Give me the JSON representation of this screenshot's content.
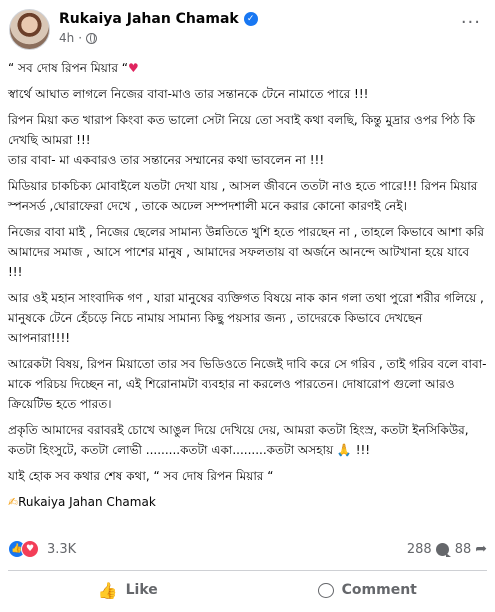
{
  "author": {
    "name": "Rukaiya Jahan Chamak",
    "time": "4h",
    "verified_icon": "verified-check-icon",
    "privacy_icon": "globe-icon"
  },
  "menu": {
    "icon": "more-options-icon",
    "label": "···"
  },
  "post": {
    "line1_text": "“ সব দোষ রিপন মিয়ার “",
    "line1_emoji": "♥",
    "p1": "স্বার্থে আঘাত লাগলে নিজের বাবা-মাও তার সন্তানকে টেনে নামাতে পারে !!!",
    "p2": "রিপন মিয়া কত খারাপ কিংবা কত ভালো সেটা নিয়ে তো সবাই কথা বলছি, কিন্তু মুদ্রার ওপর পিঠ কি দেখছি আমরা !!!",
    "p3": "তার বাবা- মা একবারও তার সন্তানের সম্মানের কথা ভাবলেন না !!!",
    "p4": "মিডিয়ার চাকচিক্য মোবাইলে যতটা দেখা যায় , আসল জীবনে ততটা নাও হতে পারে!!! রিপন মিয়ার স্পনসর্ড ,ঘোরাফেরা  দেখে , তাকে অঢেল সম্পদশালী মনে করার কোনো কারণই নেই।",
    "p5": "নিজের বাবা মাই , নিজের ছেলের সামান্য উন্নতিতে খুশি হতে পারছেন না , তাহলে কিভাবে আশা করি আমাদের সমাজ , আসে পাশের মানুষ , আমাদের সফলতায় বা অর্জনে আনন্দে আটখানা হয়ে যাবে !!!",
    "p6": "আর ওই মহান সাংবাদিক গণ , যারা মানুষের ব্যক্তিগত বিষয়ে নাক কান গলা তথা পুরো শরীর গলিয়ে , মানুষকে টেনে হেঁচড়ে নিচে নামায় সামান্য কিছু পয়সার জন্য , তাদেরকে কিভাবে দেখছেন আপনারা!!!!",
    "p7": "আরেকটা বিষয়, রিপন মিয়াতো তার সব ভিডিওতে নিজেই দাবি করে সে গরিব , তাই গরিব বলে বাবা- মাকে পরিচয় দিচ্ছেন না, এই শিরোনামটা ব্যবহার না করলেও পারতেন। দোষারোপ গুলো আরও ক্রিয়েটিভ হতে পারত।",
    "p8_text": "প্রকৃতি আমাদের বরাবরই চোখে আঙুল দিয়ে দেখিয়ে দেয়, আমরা কতটা হিংস্র, কতটা ইনসিকিউর, কতটা হিংসুটে, কতটা লোভী .........কতটা একা.........কতটা অসহায়",
    "p8_emoji": "🙏",
    "p8_end": "!!!",
    "p9": "যাই হোক সব কথার শেষ কথা, “ সব দোষ রিপন মিয়ার “",
    "signature_emoji": "✍",
    "signature": "Rukaiya Jahan Chamak"
  },
  "stats": {
    "reaction_count": "3.3K",
    "reaction_icons": [
      "like-reaction-icon",
      "love-reaction-icon"
    ],
    "comments": "288",
    "shares": "88"
  },
  "actions": {
    "like": "Like",
    "comment": "Comment"
  },
  "colors": {
    "accent": "#1877f2",
    "love": "#f33e58",
    "muted": "#65676b",
    "text": "#050505"
  }
}
